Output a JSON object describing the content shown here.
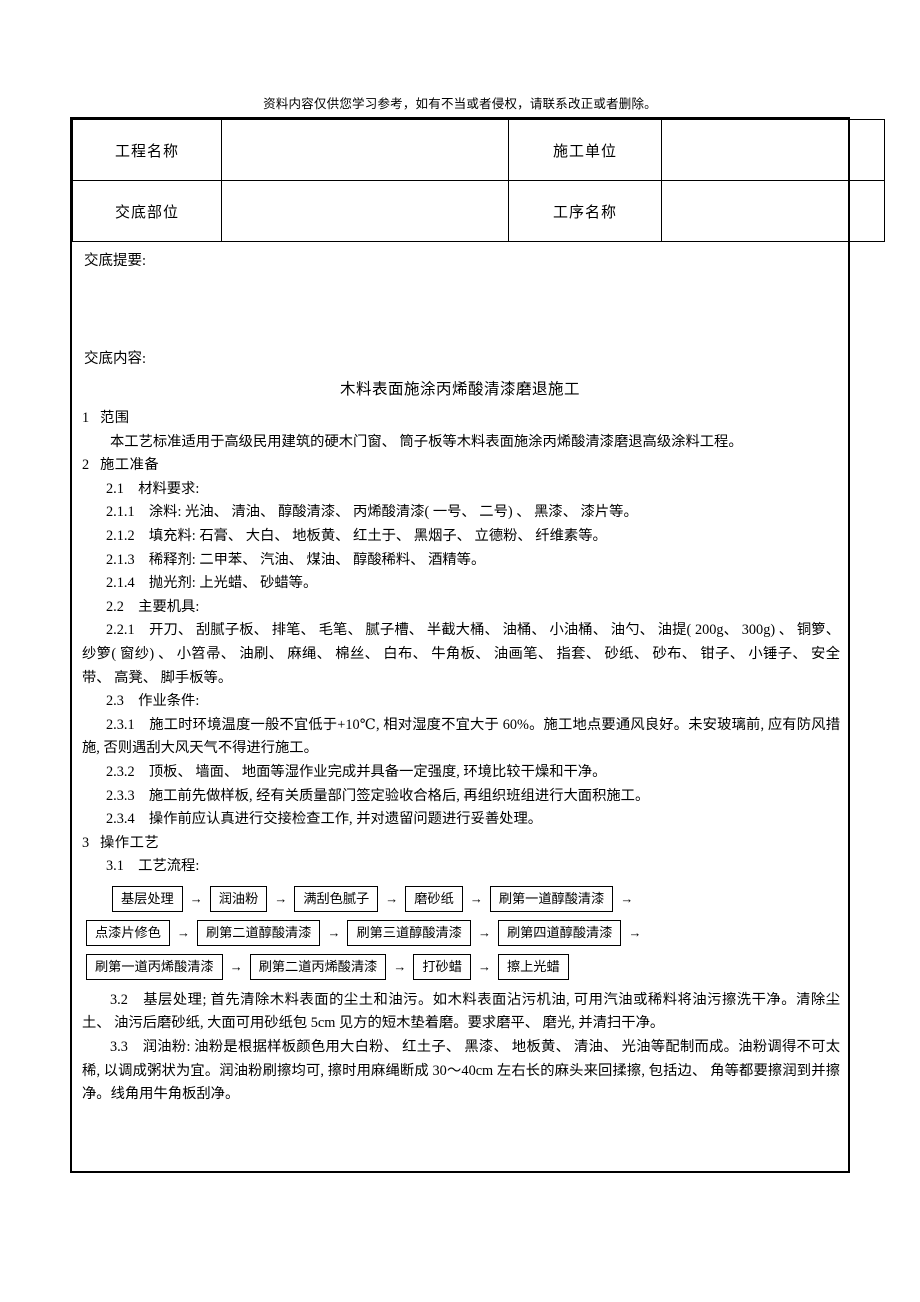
{
  "disclaimer": "资料内容仅供您学习参考，如有不当或者侵权，请联系改正或者删除。",
  "info_table": {
    "rows": [
      {
        "label_left": "工程名称",
        "value_left": "",
        "label_right": "施工单位",
        "value_right": ""
      },
      {
        "label_left": "交底部位",
        "value_left": "",
        "label_right": "工序名称",
        "value_right": ""
      }
    ]
  },
  "brief_label": "交底提要:",
  "content_label": "交底内容:",
  "doc_title": "木料表面施涂丙烯酸清漆磨退施工",
  "sections": {
    "s1_num": "1",
    "s1_title": "范围",
    "s1_body": "本工艺标准适用于高级民用建筑的硬木门窗、 筒子板等木料表面施涂丙烯酸清漆磨退高级涂料工程。",
    "s2_num": "2",
    "s2_title": "施工准备",
    "s2_1": "2.1　材料要求:",
    "s2_1_1": "2.1.1　涂料: 光油、 清油、 醇酸清漆、 丙烯酸清漆( 一号、 二号) 、 黑漆、 漆片等。",
    "s2_1_2": "2.1.2　填充料: 石膏、 大白、 地板黄、 红土于、 黑烟子、 立德粉、 纤维素等。",
    "s2_1_3": "2.1.3　稀释剂: 二甲苯、 汽油、 煤油、 醇酸稀料、 酒精等。",
    "s2_1_4": "2.1.4　抛光剂: 上光蜡、 砂蜡等。",
    "s2_2": "2.2　主要机具:",
    "s2_2_1": "2.2.1　开刀、 刮腻子板、 排笔、 毛笔、 腻子槽、 半截大桶、 油桶、 小油桶、 油勺、 油提( 200g、 300g) 、 铜箩、 纱箩( 窗纱) 、 小笤帚、 油刷、 麻绳、 棉丝、 白布、 牛角板、 油画笔、 指套、 砂纸、 砂布、 钳子、 小锤子、 安全带、 高凳、 脚手板等。",
    "s2_3": "2.3　作业条件:",
    "s2_3_1": "2.3.1　施工时环境温度一般不宜低于+10℃, 相对湿度不宜大于 60%。施工地点要通风良好。未安玻璃前, 应有防风措施, 否则遇刮大风天气不得进行施工。",
    "s2_3_2": "2.3.2　顶板、 墙面、 地面等湿作业完成并具备一定强度, 环境比较干燥和干净。",
    "s2_3_3": "2.3.3　施工前先做样板, 经有关质量部门签定验收合格后, 再组织班组进行大面积施工。",
    "s2_3_4": "2.3.4　操作前应认真进行交接检查工作, 并对遗留问题进行妥善处理。",
    "s3_num": "3",
    "s3_title": "操作工艺",
    "s3_1": "3.1　工艺流程:",
    "s3_2": "3.2　基层处理; 首先清除木料表面的尘土和油污。如木料表面沾污机油, 可用汽油或稀料将油污擦洗干净。清除尘土、 油污后磨砂纸, 大面可用砂纸包 5cm 见方的短木垫着磨。要求磨平、 磨光, 并清扫干净。",
    "s3_3": "3.3　润油粉: 油粉是根据样板颜色用大白粉、 红土子、 黑漆、 地板黄、 清油、 光油等配制而成。油粉调得不可太稀, 以调成粥状为宜。润油粉刷擦均可, 擦时用麻绳断成 30～40cm 左右长的麻头来回揉擦, 包括边、 角等都要擦润到并擦净。线角用牛角板刮净。"
  },
  "flow": {
    "arrow": "→",
    "row1": [
      "基层处理",
      "润油粉",
      "满刮色腻子",
      "磨砂纸",
      "刷第一道醇酸清漆"
    ],
    "row1_trailing_arrow": "→",
    "row2": [
      "点漆片修色",
      "刷第二道醇酸清漆",
      "刷第三道醇酸清漆",
      "刷第四道醇酸清漆"
    ],
    "row2_trailing_arrow": "→",
    "row3": [
      "刷第一道丙烯酸清漆",
      "刷第二道丙烯酸清漆",
      "打砂蜡",
      "擦上光蜡"
    ]
  }
}
